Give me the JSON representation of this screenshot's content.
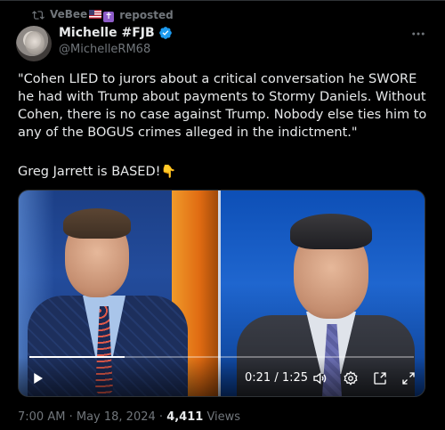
{
  "repost": {
    "user": "VeBee",
    "suffix": "reposted"
  },
  "author": {
    "display_name": "Michelle #FJB",
    "handle": "@MichelleRM68"
  },
  "tweet": {
    "paragraph1": "\"Cohen LIED to jurors about a critical conversation he SWORE he had with Trump about payments to Stormy Daniels. Without Cohen, there is no case against Trump. Nobody else ties him to any of the BOGUS crimes alleged in the indictment.\"",
    "paragraph2": "Greg Jarrett is BASED!"
  },
  "video": {
    "time": "0:21 / 1:25",
    "progress_fraction": 0.247
  },
  "meta": {
    "time": "7:00 AM",
    "sep": "·",
    "date": "May 18, 2024",
    "views_count": "4,411",
    "views_label": "Views"
  },
  "colors": {
    "accent": "#1d9bf0",
    "muted": "#71767b",
    "text": "#e7e9ea"
  }
}
